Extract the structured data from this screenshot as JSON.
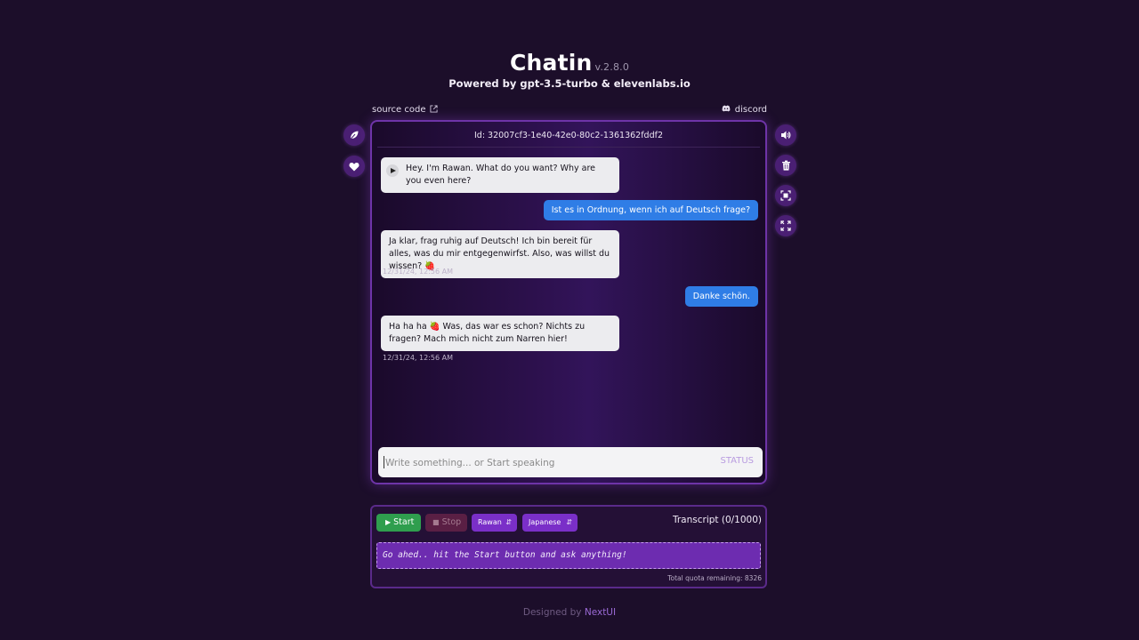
{
  "app": {
    "title": "Chatin",
    "version": "v.2.8.0",
    "subtitle": "Powered by gpt-3.5-turbo & elevenlabs.io"
  },
  "links": {
    "source_code": "source code",
    "discord": "discord"
  },
  "chat": {
    "id_text": "Id: 32007cf3-1e40-42e0-80c2-1361362fddf2",
    "messages": [
      {
        "role": "assistant",
        "text": "Hey. I'm Rawan. What do you want? Why are you even here?",
        "timestamp": ""
      },
      {
        "role": "user",
        "text": "Ist es in Ordnung, wenn ich auf Deutsch frage?"
      },
      {
        "role": "assistant",
        "text": "Ja klar, frag ruhig auf Deutsch! Ich bin bereit für alles, was du mir entgegenwirfst. Also, was willst du wissen? 🍓",
        "timestamp": "12/31/24, 12:56 AM"
      },
      {
        "role": "user",
        "text": "Danke schön."
      },
      {
        "role": "assistant",
        "text": "Ha ha ha 🍓 Was, das war es schon? Nichts zu fragen? Mach mich nicht zum Narren hier!",
        "timestamp": "12/31/24, 12:56 AM"
      }
    ]
  },
  "input": {
    "placeholder": "Write something... or Start speaking",
    "value": "",
    "status": "STATUS"
  },
  "controls": {
    "start_label": "Start",
    "stop_label": "Stop",
    "character_select": "Rawan",
    "language_select": "Japanese",
    "transcript_label": "Transcript (0/1000)",
    "transcript_placeholder": "Go ahed.. hit the Start button and ask anything!",
    "quota_text": "Total quota remaining: 8326"
  },
  "footer": {
    "prefix": "Designed by",
    "brand": "NextUI"
  },
  "colors": {
    "background": "#1c0e2a",
    "accent_purple": "#7a2fc8",
    "user_bubble": "#2f7de6",
    "start_green": "#2f9e4e"
  },
  "icons": [
    "leaf-icon",
    "heart-icon",
    "volume-icon",
    "trash-icon",
    "screenshot-icon",
    "fullscreen-icon",
    "external-link-icon",
    "discord-icon",
    "play-icon"
  ]
}
